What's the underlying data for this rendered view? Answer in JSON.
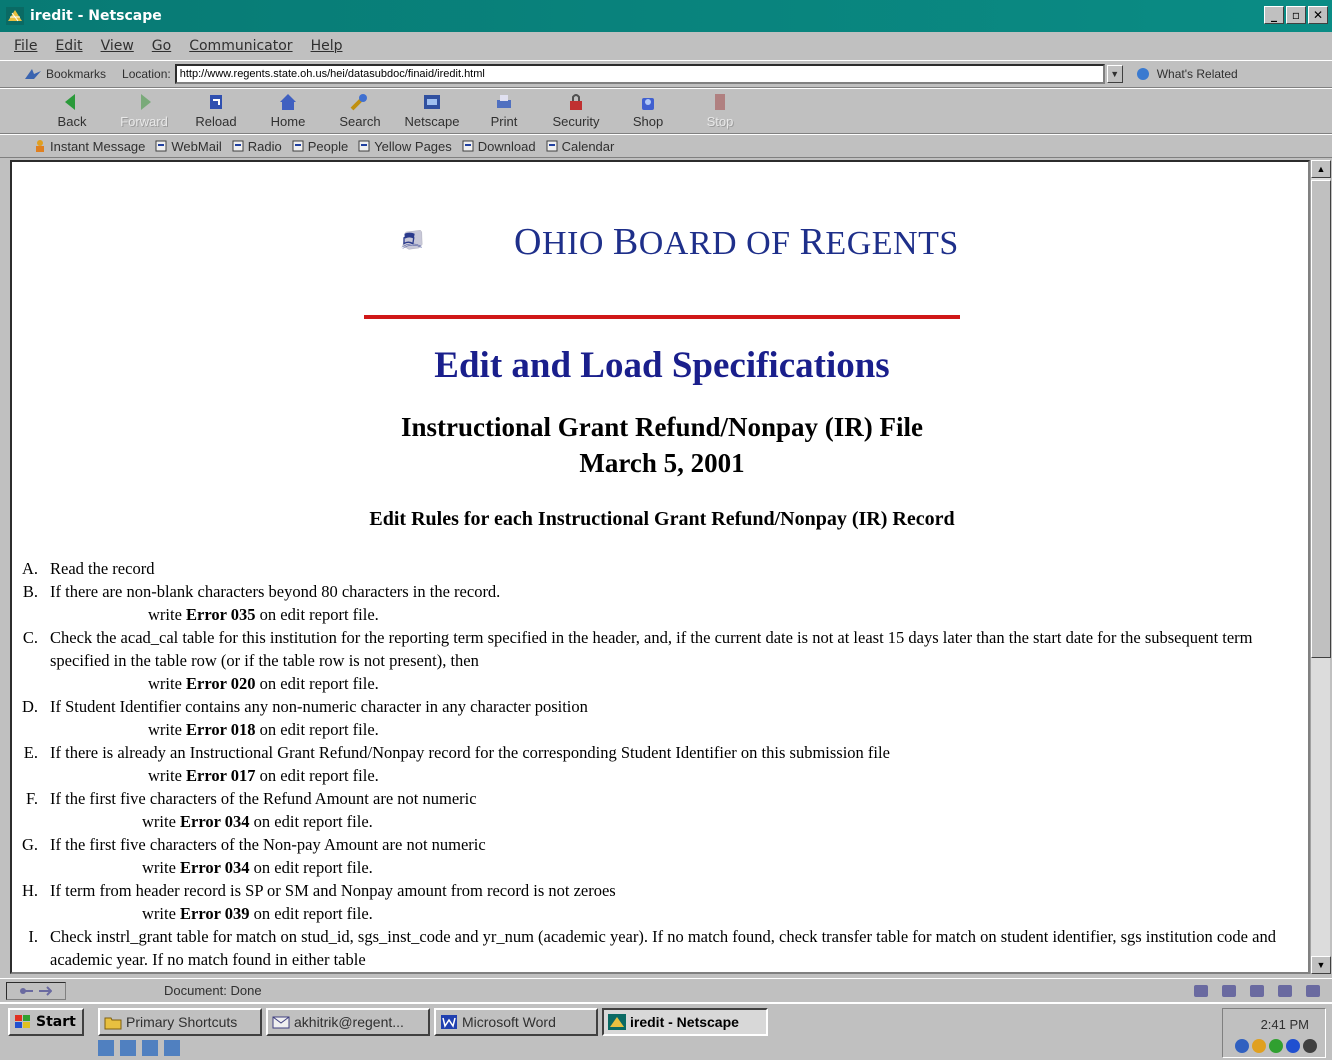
{
  "window": {
    "title": "iredit - Netscape"
  },
  "menu": [
    "File",
    "Edit",
    "View",
    "Go",
    "Communicator",
    "Help"
  ],
  "location_bar": {
    "bookmarks_label": "Bookmarks",
    "location_label": "Location:",
    "url": "http://www.regents.state.oh.us/hei/datasubdoc/finaid/iredit.html",
    "whats_related": "What's Related"
  },
  "nav_buttons": {
    "back": "Back",
    "forward": "Forward",
    "reload": "Reload",
    "home": "Home",
    "search": "Search",
    "netscape": "Netscape",
    "print": "Print",
    "security": "Security",
    "shop": "Shop",
    "stop": "Stop"
  },
  "personal_bar": {
    "instant_message": "Instant Message",
    "webmail": "WebMail",
    "radio": "Radio",
    "people": "People",
    "yellow_pages": "Yellow Pages",
    "download": "Download",
    "calendar": "Calendar"
  },
  "page": {
    "logo_text": {
      "o": "O",
      "hio": "HIO ",
      "b": "B",
      "oard": "OARD OF ",
      "r": "R",
      "egents": "EGENTS"
    },
    "title": "Edit and Load Specifications",
    "subtitle_line1": "Instructional Grant Refund/Nonpay (IR) File",
    "subtitle_line2": "March 5, 2001",
    "section_heading": "Edit Rules for each Instructional Grant Refund/Nonpay (IR) Record",
    "write": "write",
    "on_report": "on edit report file.",
    "rules": {
      "A": {
        "letter": "A.",
        "text": "Read the record"
      },
      "B": {
        "letter": "B.",
        "text": "If there are non-blank characters beyond 80 characters in the record.",
        "error": "Error 035"
      },
      "C": {
        "letter": "C.",
        "text": "Check the acad_cal table for this institution for the reporting term specified in the header, and, if the current date is not at least 15 days later than the start date for the subsequent term specified in the table row (or if the table row is not present), then",
        "error": "Error 020"
      },
      "D": {
        "letter": "D.",
        "text": "If Student Identifier contains any non-numeric character in any character position",
        "error": "Error 018"
      },
      "E": {
        "letter": "E.",
        "text": "If there is already an Instructional Grant Refund/Nonpay record for the corresponding Student Identifier on this submission file",
        "error": "Error 017"
      },
      "F": {
        "letter": "F.",
        "text": "If the first five characters of the Refund Amount are not numeric",
        "error": "Error 034"
      },
      "G": {
        "letter": "G.",
        "text": "If the first five characters of the Non-pay Amount are not numeric",
        "error": "Error 034"
      },
      "H": {
        "letter": "H.",
        "text": "If term from header record is SP or SM and Nonpay amount from record is not zeroes",
        "error": "Error 039"
      },
      "I": {
        "letter": "I.",
        "text": "Check instrl_grant table for match on stud_id, sgs_inst_code and yr_num (academic year). If no match found, check transfer table for match on student identifier, sgs institution code and academic year. If no match found in either table"
      }
    }
  },
  "status": {
    "text": "Document: Done"
  },
  "taskbar": {
    "start": "Start",
    "tasks": [
      "Primary Shortcuts",
      "akhitrik@regent...",
      "Microsoft Word",
      "iredit - Netscape"
    ],
    "clock": "2:41 PM"
  }
}
